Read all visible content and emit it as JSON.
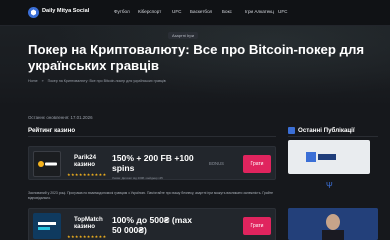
{
  "site": {
    "name": "Daily Mitya Social"
  },
  "nav": {
    "items": [
      "Футбол",
      "Кіберспорт",
      "UFC",
      "Баскетбол",
      "Бокс",
      "Ігри Алкатекц",
      "UFC"
    ]
  },
  "hero": {
    "tag": "Азартні Ігри",
    "title": "Покер на Криптовалюту: Все про Bitcoin-покер для українських гравців",
    "breadcrumb": [
      "Home",
      "»",
      "Покер на Криптовалюту: Все про Bitcoin-покер для українських гравців"
    ]
  },
  "content": {
    "updated": "Останнє оновлення: 17.01.2026",
    "section_title": "Рейтинг казино",
    "casinos": [
      {
        "name_line1": "Parik24",
        "name_line2": "казино",
        "stars": "★★★★★★★★★★",
        "bonus_line1": "150% + 200 FB +100",
        "bonus_line2": "spins",
        "terms": "Умови: Депозит від 200₴ • вейджер х35",
        "code": "BONUS",
        "button": "Грати",
        "logo_color": "#1b1d20"
      },
      {
        "name_line1": "TopMatch",
        "name_line2": "казино",
        "stars": "★★★★★★★★★★",
        "bonus_line1": "100% до 500₴ (max",
        "bonus_line2": "50 000₴)",
        "terms": "",
        "code": "",
        "button": "Грати",
        "logo_color": "#0f3a5f"
      }
    ],
    "disclaimer": "Заснований у 2023 році. Програма по взаємодопомозі гравцям з Україною. Пам'ятайте про вашу безпеку, азартні ігри можуть викликати залежність. Грайте відповідально."
  },
  "sidebar": {
    "title": "Останні Публікації"
  },
  "colors": {
    "accent": "#e0245e",
    "brand": "#3b6fd6",
    "stars": "#f5b31d"
  }
}
